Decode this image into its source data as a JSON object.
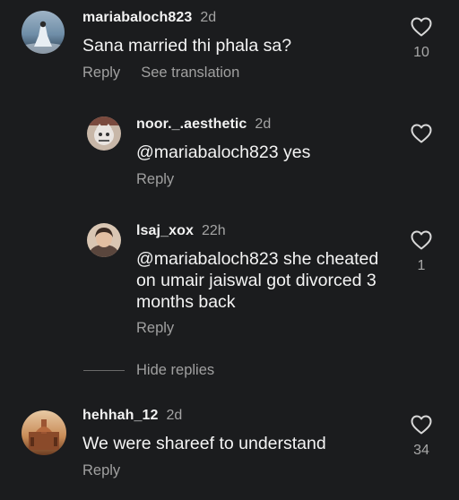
{
  "comments": [
    {
      "username": "mariabaloch823",
      "time": "2d",
      "text": "Sana married thi phala sa?",
      "reply_label": "Reply",
      "translate_label": "See translation",
      "likes": "10"
    }
  ],
  "replies": [
    {
      "username": "noor._.aesthetic",
      "time": "2d",
      "text": "@mariabaloch823 yes",
      "reply_label": "Reply",
      "likes": ""
    },
    {
      "username": "lsaj_xox",
      "time": "22h",
      "text_lines": [
        "@mariabaloch823 she cheated",
        "on umair jaiswal got divorced 3",
        "months back"
      ],
      "reply_label": "Reply",
      "likes": "1"
    }
  ],
  "hide_replies_label": "Hide replies",
  "second_comment": {
    "username": "hehhah_12",
    "time": "2d",
    "text": "We were shareef to understand",
    "reply_label": "Reply",
    "likes": "34"
  },
  "icons": {
    "like": "heart-outline-icon"
  },
  "colors": {
    "background": "#1b1c1e",
    "text": "#f4f4f4",
    "secondary": "#a0a0a0"
  }
}
